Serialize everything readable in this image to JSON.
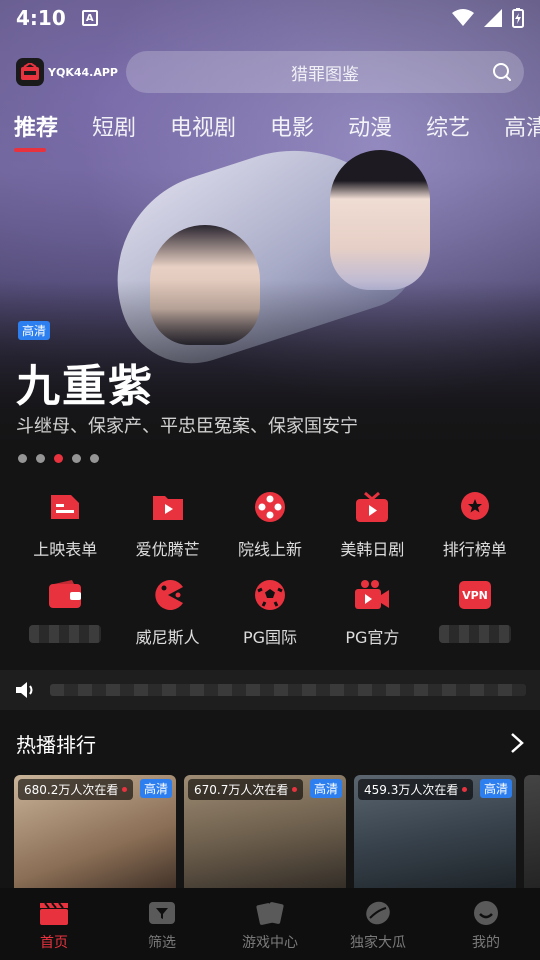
{
  "status": {
    "time": "4:10"
  },
  "header": {
    "logo_text": "YQK44.APP",
    "search_placeholder": "猎罪图鉴"
  },
  "tabs": [
    {
      "label": "推荐",
      "active": true
    },
    {
      "label": "短剧"
    },
    {
      "label": "电视剧"
    },
    {
      "label": "电影"
    },
    {
      "label": "动漫"
    },
    {
      "label": "综艺"
    },
    {
      "label": "高清"
    }
  ],
  "hero": {
    "badge": "高清",
    "title": "九重紫",
    "subtitle": "斗继母、保家产、平忠臣冤案、保家国安宁",
    "dots_count": 5,
    "active_dot": 2
  },
  "grid": [
    {
      "label": "上映表单",
      "icon": "list-icon"
    },
    {
      "label": "爱优腾芒",
      "icon": "play-folder-icon"
    },
    {
      "label": "院线上新",
      "icon": "film-reel-icon"
    },
    {
      "label": "美韩日剧",
      "icon": "tv-icon"
    },
    {
      "label": "排行榜单",
      "icon": "star-badge-icon"
    },
    {
      "label": "",
      "icon": "wallet-icon",
      "blurred": true
    },
    {
      "label": "威尼斯人",
      "icon": "pacman-icon"
    },
    {
      "label": "PG国际",
      "icon": "soccer-ball-icon"
    },
    {
      "label": "PG官方",
      "icon": "video-camera-icon"
    },
    {
      "label": "",
      "icon": "vpn-icon",
      "icon_text": "VPN",
      "blurred": true
    }
  ],
  "section": {
    "title": "热播排行"
  },
  "cards": [
    {
      "views": "680.2万人次在看",
      "badge": "高清"
    },
    {
      "views": "670.7万人次在看",
      "badge": "高清"
    },
    {
      "views": "459.3万人次在看",
      "badge": "高清"
    }
  ],
  "bottom_nav": [
    {
      "label": "首页",
      "icon": "clapperboard-icon",
      "active": true
    },
    {
      "label": "筛选",
      "icon": "filter-icon"
    },
    {
      "label": "游戏中心",
      "icon": "cards-icon"
    },
    {
      "label": "独家大瓜",
      "icon": "melon-icon"
    },
    {
      "label": "我的",
      "icon": "profile-icon"
    }
  ],
  "colors": {
    "accent": "#e8333f",
    "badge_blue": "#2d7ff0",
    "background": "#141414"
  }
}
